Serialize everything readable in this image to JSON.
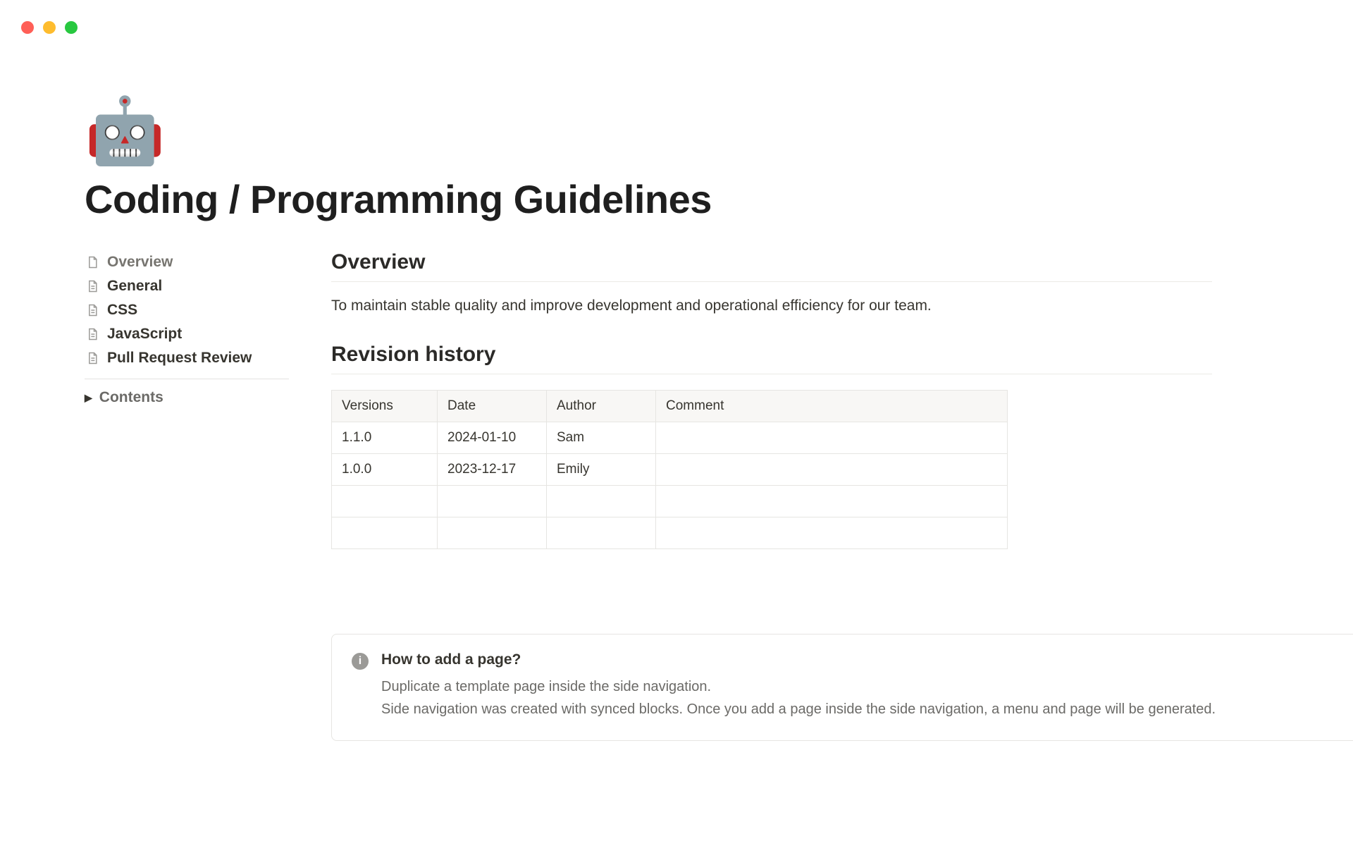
{
  "page": {
    "icon": "🤖",
    "title": "Coding / Programming Guidelines"
  },
  "sidebar": {
    "items": [
      {
        "label": "Overview",
        "active": true
      },
      {
        "label": "General",
        "active": false
      },
      {
        "label": "CSS",
        "active": false
      },
      {
        "label": "JavaScript",
        "active": false
      },
      {
        "label": "Pull Request Review",
        "active": false
      }
    ],
    "toggle_label": "Contents"
  },
  "overview": {
    "heading": "Overview",
    "text": "To maintain stable quality and improve development and operational efficiency for our team."
  },
  "revision": {
    "heading": "Revision history",
    "columns": [
      "Versions",
      "Date",
      "Author",
      "Comment"
    ],
    "rows": [
      {
        "version": "1.1.0",
        "date": "2024-01-10",
        "author": "Sam",
        "comment": ""
      },
      {
        "version": "1.0.0",
        "date": "2023-12-17",
        "author": "Emily",
        "comment": ""
      },
      {
        "version": "",
        "date": "",
        "author": "",
        "comment": ""
      },
      {
        "version": "",
        "date": "",
        "author": "",
        "comment": ""
      }
    ]
  },
  "callout": {
    "title": "How to add a page?",
    "line1": "Duplicate a template page inside the side navigation.",
    "line2": "Side navigation was created with synced blocks. Once you add a page inside the side navigation, a menu and page will be generated."
  }
}
